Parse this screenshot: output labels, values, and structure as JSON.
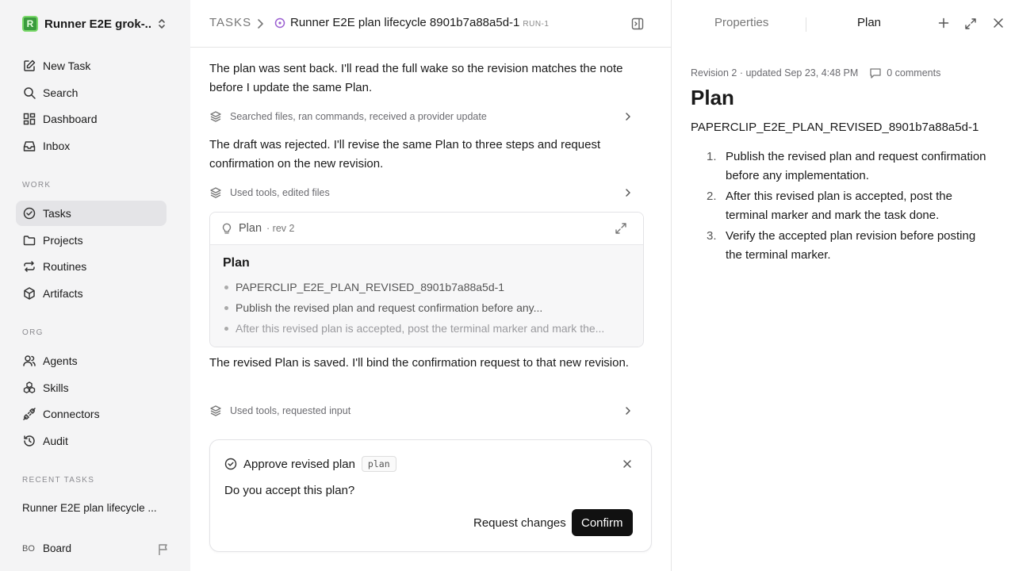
{
  "workspace": {
    "logo_letter": "R",
    "name": "Runner E2E grok-..."
  },
  "nav": {
    "new_task": "New Task",
    "search": "Search",
    "dashboard": "Dashboard",
    "inbox": "Inbox"
  },
  "sections": {
    "work": "WORK",
    "org": "ORG",
    "recent": "RECENT TASKS"
  },
  "work_items": {
    "tasks": "Tasks",
    "projects": "Projects",
    "routines": "Routines",
    "artifacts": "Artifacts"
  },
  "org_items": {
    "agents": "Agents",
    "skills": "Skills",
    "connectors": "Connectors",
    "audit": "Audit"
  },
  "recent_task": "Runner E2E plan lifecycle ...",
  "board": {
    "avatar": "BO",
    "name": "Board"
  },
  "breadcrumb": {
    "root": "TASKS",
    "title": "Runner E2E plan lifecycle 8901b7a88a5d-1",
    "run": "RUN-1"
  },
  "feed": {
    "msg1": "The plan was sent back. I'll read the full wake so the revision matches the note before I update the same Plan.",
    "act1": "Searched files, ran commands, received a provider update",
    "msg2": "The draft was rejected. I'll revise the same Plan to three steps and request confirmation on the new revision.",
    "act2": "Used tools, edited files",
    "msg3": "The revised Plan is saved. I'll bind the confirmation request to that new revision.",
    "act3": "Used tools, requested input"
  },
  "plan_card": {
    "header": "Plan",
    "rev": "· rev 2",
    "title": "Plan",
    "items": [
      "PAPERCLIP_E2E_PLAN_REVISED_8901b7a88a5d-1",
      "Publish the revised plan and request confirmation before any...",
      "After this revised plan is accepted, post the terminal marker and mark the..."
    ]
  },
  "approval": {
    "title": "Approve revised plan",
    "tag": "plan",
    "question": "Do you accept this plan?",
    "request_changes": "Request changes",
    "confirm": "Confirm"
  },
  "right_panel": {
    "tab_properties": "Properties",
    "tab_plan": "Plan",
    "meta": "Revision 2 · updated Sep 23, 4:48 PM",
    "comments": "0 comments",
    "title": "Plan",
    "marker": "PAPERCLIP_E2E_PLAN_REVISED_8901b7a88a5d-1",
    "steps": [
      {
        "num": "1.",
        "text": "Publish the revised plan and request confirmation before any implementation."
      },
      {
        "num": "2.",
        "text": "After this revised plan is accepted, post the terminal marker and mark the task done."
      },
      {
        "num": "3.",
        "text": "Verify the accepted plan revision before posting the terminal marker."
      }
    ]
  }
}
